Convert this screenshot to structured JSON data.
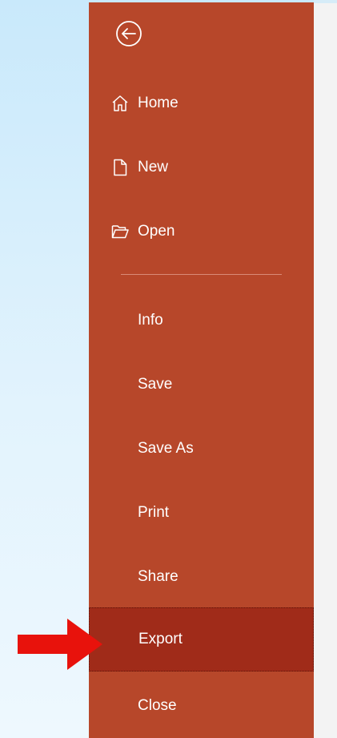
{
  "backstage": {
    "back_icon": "back-arrow-circle-icon",
    "accent_color": "#b7472a",
    "selected_color": "#a02b19",
    "top_items": [
      {
        "label": "Home",
        "icon": "home-icon"
      },
      {
        "label": "New",
        "icon": "new-document-icon"
      },
      {
        "label": "Open",
        "icon": "open-folder-icon"
      }
    ],
    "items": [
      {
        "label": "Info"
      },
      {
        "label": "Save"
      },
      {
        "label": "Save As"
      },
      {
        "label": "Print"
      },
      {
        "label": "Share"
      },
      {
        "label": "Export",
        "selected": true
      },
      {
        "label": "Close"
      }
    ]
  },
  "annotation": {
    "arrow_color": "#e8120c",
    "arrow_icon": "red-arrow-icon"
  }
}
